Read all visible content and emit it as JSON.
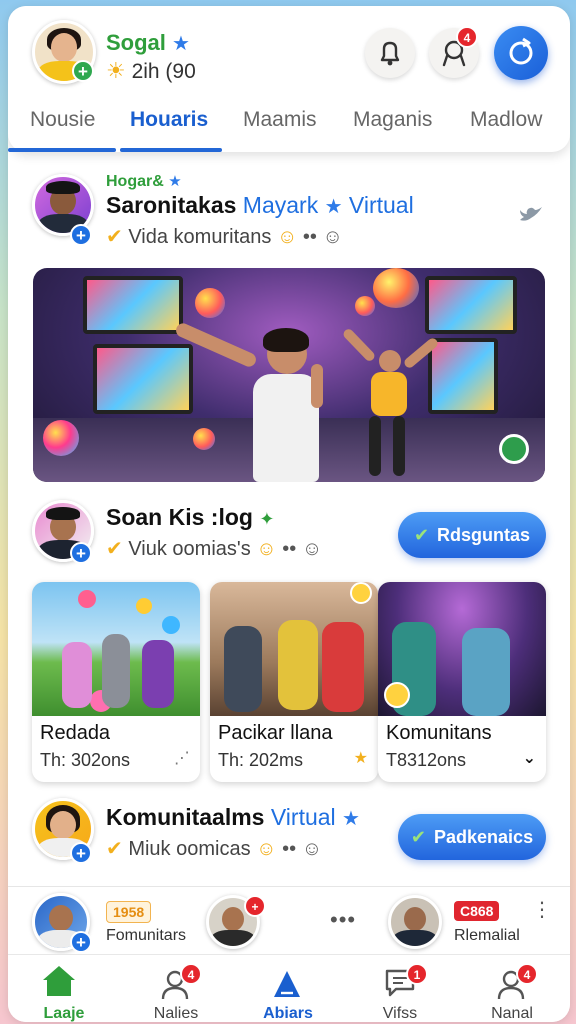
{
  "header": {
    "user_name": "Sogal",
    "user_status": "2ih (90",
    "tabs": [
      {
        "label": "Nousie",
        "active": false
      },
      {
        "label": "Houaris",
        "active": true
      },
      {
        "label": "Maamis",
        "active": false
      },
      {
        "label": "Maganis",
        "active": false
      },
      {
        "label": "Madlow",
        "active": false
      }
    ],
    "bell_icon": "bell-icon",
    "badge_count": "4",
    "refresh_icon": "refresh-icon"
  },
  "posts": [
    {
      "tag": "Hogar&",
      "name": "Saronitakas",
      "name_suffix": "Mayark",
      "name_extra": "Virtual",
      "meta": "Vida komuritans",
      "extra_icon": "bird-icon"
    },
    {
      "name": "Soan Kis :log",
      "meta": "Viuk oomias's",
      "button": "Rdsguntas"
    },
    {
      "name": "Komunitaalms",
      "name_suffix": "Virtual",
      "meta": "Miuk oomicas",
      "button": "Padkenaics"
    }
  ],
  "cards": [
    {
      "title": "Redada",
      "sub": "Th: 302ons",
      "corner": "⋰"
    },
    {
      "title": "Pacikar llana",
      "sub": "Th: 202ms",
      "corner": "★"
    },
    {
      "title": "Komunitans",
      "sub": "T8312ons",
      "corner": "⌄"
    }
  ],
  "strip": {
    "badge_left": "1958",
    "label_left": "Fomunitars",
    "badge_right": "C868",
    "label_right": "Rlemalial",
    "mid_badge": "+"
  },
  "nav": [
    {
      "label": "Laaje",
      "icon": "home-icon",
      "badge": ""
    },
    {
      "label": "Nalies",
      "icon": "profile-icon",
      "badge": "4"
    },
    {
      "label": "Abiars",
      "icon": "share-icon",
      "badge": ""
    },
    {
      "label": "Vifss",
      "icon": "chat-icon",
      "badge": "1"
    },
    {
      "label": "Nanal",
      "icon": "user-icon",
      "badge": "4"
    }
  ],
  "colors": {
    "accent": "#1a5fcf",
    "green": "#2f9e3b",
    "notification": "#e5262c"
  }
}
